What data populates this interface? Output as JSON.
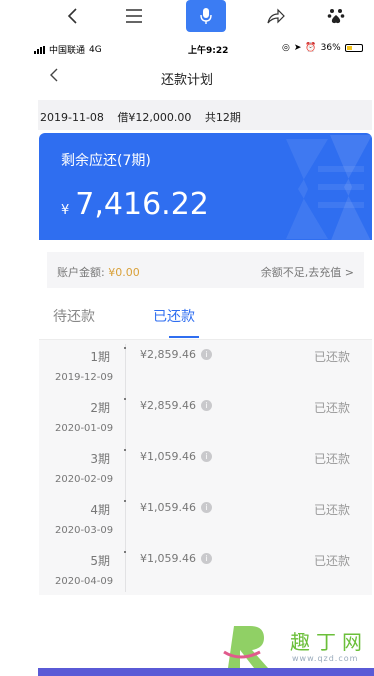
{
  "browser_toolbar": {
    "icons": [
      "chevron-left-icon",
      "menu-icon",
      "microphone-icon",
      "share-icon",
      "baidu-paw-icon"
    ],
    "mic_color": "#3b7cf3"
  },
  "status_bar": {
    "carrier": "中国联通",
    "network": "4G",
    "time": "上午9:22",
    "battery": "36%",
    "battery_level": 0.36
  },
  "nav": {
    "title": "还款计划"
  },
  "summary": {
    "date": "2019-11-08",
    "loan": "借¥12,000.00",
    "periods": "共12期"
  },
  "card": {
    "label": "剩余应还(7期)",
    "currency": "¥",
    "amount": "7,416.22",
    "color": "#2f6ef0"
  },
  "balance": {
    "label": "账户金额: ",
    "value": "¥0.00",
    "action": "余额不足,去充值 >"
  },
  "tabs": {
    "pending": "待还款",
    "repaid": "已还款"
  },
  "payments": [
    {
      "term": "1期",
      "date": "2019-12-09",
      "amount": "¥2,859.46",
      "status": "已还款"
    },
    {
      "term": "2期",
      "date": "2020-01-09",
      "amount": "¥2,859.46",
      "status": "已还款"
    },
    {
      "term": "3期",
      "date": "2020-02-09",
      "amount": "¥1,059.46",
      "status": "已还款"
    },
    {
      "term": "4期",
      "date": "2020-03-09",
      "amount": "¥1,059.46",
      "status": "已还款"
    },
    {
      "term": "5期",
      "date": "2020-04-09",
      "amount": "¥1,059.46",
      "status": "已还款"
    }
  ],
  "watermark": {
    "text": "趣丁网",
    "url": "www.qzd.com"
  }
}
